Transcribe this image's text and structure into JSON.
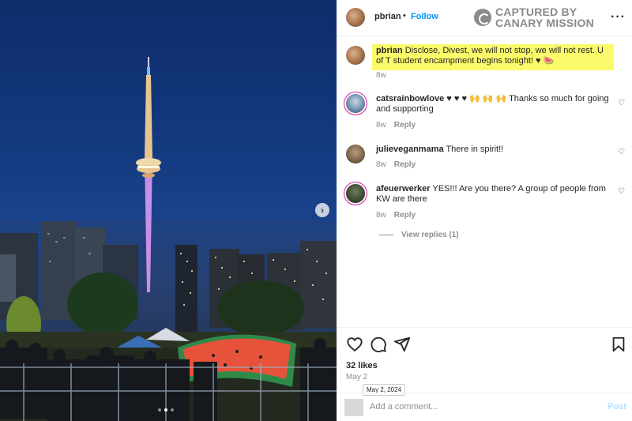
{
  "post_author": {
    "username": "pbrian",
    "separator": "•",
    "follow_label": "Follow"
  },
  "watermark": {
    "line1": "CAPTURED BY",
    "line2": "CANARY MISSION",
    "color": "#8a8a8a"
  },
  "more_icon": "more-horizontal-icon",
  "caption": {
    "username": "pbrian",
    "text": "Disclose, Divest, we will not stop, we will not rest. U of T student encampment begins tonight! ♥ 🍉",
    "age": "8w",
    "highlight_color": "#fbfa6a"
  },
  "comments": [
    {
      "username": "catsrainbowlove",
      "text": "♥ ♥ ♥ 🙌 🙌 🙌 Thanks so much for going and supporting",
      "age": "8w",
      "reply_label": "Reply"
    },
    {
      "username": "julieveganmama",
      "text": "There in spirit!!",
      "age": "8w",
      "reply_label": "Reply"
    },
    {
      "username": "afeuerwerker",
      "text": "YES!!! Are you there? A group of people from KW are there",
      "age": "8w",
      "reply_label": "Reply"
    }
  ],
  "view_replies_label": "View replies (1)",
  "action_icons": [
    "heart-icon",
    "comment-icon",
    "share-icon",
    "bookmark-icon"
  ],
  "likes": "32 likes",
  "date": "May 2",
  "date_tooltip": "May 2, 2024",
  "add_comment_placeholder": "Add a comment...",
  "post_label": "Post",
  "carousel": {
    "next_icon": "chevron-right-icon",
    "dot_count": 3,
    "active_index": 1
  },
  "colors": {
    "link_blue": "#0095f6",
    "post_disabled": "#b2dffc",
    "story_ring": "#d6249f"
  }
}
